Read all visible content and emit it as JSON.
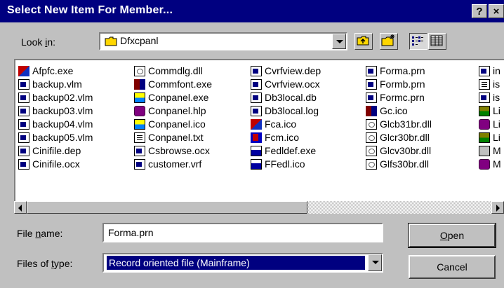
{
  "window": {
    "title": "Select New Item For Member...",
    "help_label": "?",
    "close_label": "×"
  },
  "look_in": {
    "label_pre": "Look ",
    "label_key": "i",
    "label_post": "n:",
    "value": "Dfxcpanl",
    "icon": "folder-icon"
  },
  "toolbar": {
    "up_folder_icon": "up-folder-icon",
    "new_folder_icon": "new-folder-icon",
    "list_view_icon": "list-view-icon",
    "details_view_icon": "details-view-icon"
  },
  "files": {
    "columns": [
      [
        {
          "name": "Afpfc.exe",
          "icon": "exe"
        },
        {
          "name": "backup.vlm",
          "icon": "doc"
        },
        {
          "name": "backup02.vlm",
          "icon": "doc"
        },
        {
          "name": "backup03.vlm",
          "icon": "doc"
        },
        {
          "name": "backup04.vlm",
          "icon": "doc"
        },
        {
          "name": "backup05.vlm",
          "icon": "doc"
        },
        {
          "name": "Cinifile.dep",
          "icon": "doc"
        },
        {
          "name": "Cinifile.ocx",
          "icon": "doc"
        }
      ],
      [
        {
          "name": "Commdlg.dll",
          "icon": "dll"
        },
        {
          "name": "Commfont.exe",
          "icon": "gc"
        },
        {
          "name": "Conpanel.exe",
          "icon": "ico"
        },
        {
          "name": "Conpanel.hlp",
          "icon": "hlp"
        },
        {
          "name": "Conpanel.ico",
          "icon": "ico"
        },
        {
          "name": "Conpanel.txt",
          "icon": "txt"
        },
        {
          "name": "Csbrowse.ocx",
          "icon": "doc"
        },
        {
          "name": "customer.vrf",
          "icon": "doc"
        }
      ],
      [
        {
          "name": "Cvrfview.dep",
          "icon": "doc"
        },
        {
          "name": "Cvrfview.ocx",
          "icon": "doc"
        },
        {
          "name": "Db3local.db",
          "icon": "doc"
        },
        {
          "name": "Db3local.log",
          "icon": "doc"
        },
        {
          "name": "Fca.ico",
          "icon": "exe"
        },
        {
          "name": "Fcm.ico",
          "icon": "ftm"
        },
        {
          "name": "Fedldef.exe",
          "icon": "fed"
        },
        {
          "name": "FFedl.ico",
          "icon": "fed"
        }
      ],
      [
        {
          "name": "Forma.prn",
          "icon": "doc"
        },
        {
          "name": "Formb.prn",
          "icon": "doc"
        },
        {
          "name": "Formc.prn",
          "icon": "doc"
        },
        {
          "name": "Gc.ico",
          "icon": "gc"
        },
        {
          "name": "Glcb31br.dll",
          "icon": "dll"
        },
        {
          "name": "Glcr30br.dll",
          "icon": "dll"
        },
        {
          "name": "Glcv30br.dll",
          "icon": "dll"
        },
        {
          "name": "Glfs30br.dll",
          "icon": "dll"
        }
      ],
      [
        {
          "name": "in",
          "icon": "doc"
        },
        {
          "name": "is",
          "icon": "txt"
        },
        {
          "name": "is",
          "icon": "doc"
        },
        {
          "name": "Li",
          "icon": "zip"
        },
        {
          "name": "Li",
          "icon": "hlp"
        },
        {
          "name": "Li",
          "icon": "zip"
        },
        {
          "name": "M",
          "icon": "gen"
        },
        {
          "name": "M",
          "icon": "hlp"
        }
      ]
    ]
  },
  "file_name": {
    "label_pre": "File ",
    "label_key": "n",
    "label_post": "ame:",
    "value": "Forma.prn"
  },
  "file_type": {
    "label_pre": "Files of ",
    "label_key": "t",
    "label_post": "ype:",
    "value": "Record oriented file (Mainframe)"
  },
  "buttons": {
    "open_key": "O",
    "open_rest": "pen",
    "cancel": "Cancel"
  }
}
